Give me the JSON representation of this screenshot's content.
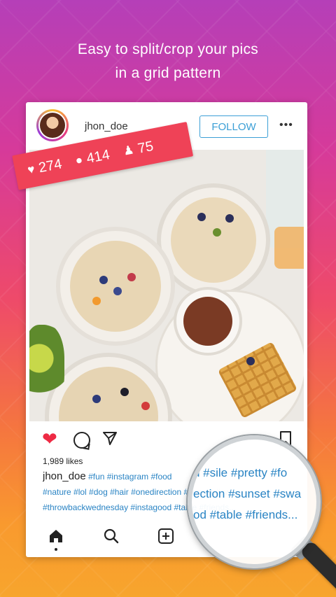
{
  "headline": {
    "line1": "Easy to split/crop your pics",
    "line2": "in a grid pattern"
  },
  "post": {
    "username": "jhon_doe",
    "follow_label": "FOLLOW",
    "more_label": "•••",
    "stats": {
      "likes": "274",
      "comments": "414",
      "followers": "75"
    },
    "likes_text": "1,989 likes",
    "caption_user": "jhon_doe",
    "caption_line1": " #fun #instagram #food",
    "caption_line2": "#nature #lol #dog #hair #onedirection #sunset #swag",
    "caption_line3": "#throwbackwednesday #instagood #table #friends..."
  },
  "magnifier": {
    "line1": "d #sile #pretty #fo",
    "line2": "ection #sunset #swa",
    "line3": "od #table #friends..."
  },
  "colors": {
    "accent_blue": "#3b9fd6",
    "heart_red": "#ee2a44",
    "banner_red": "#ef4257"
  }
}
